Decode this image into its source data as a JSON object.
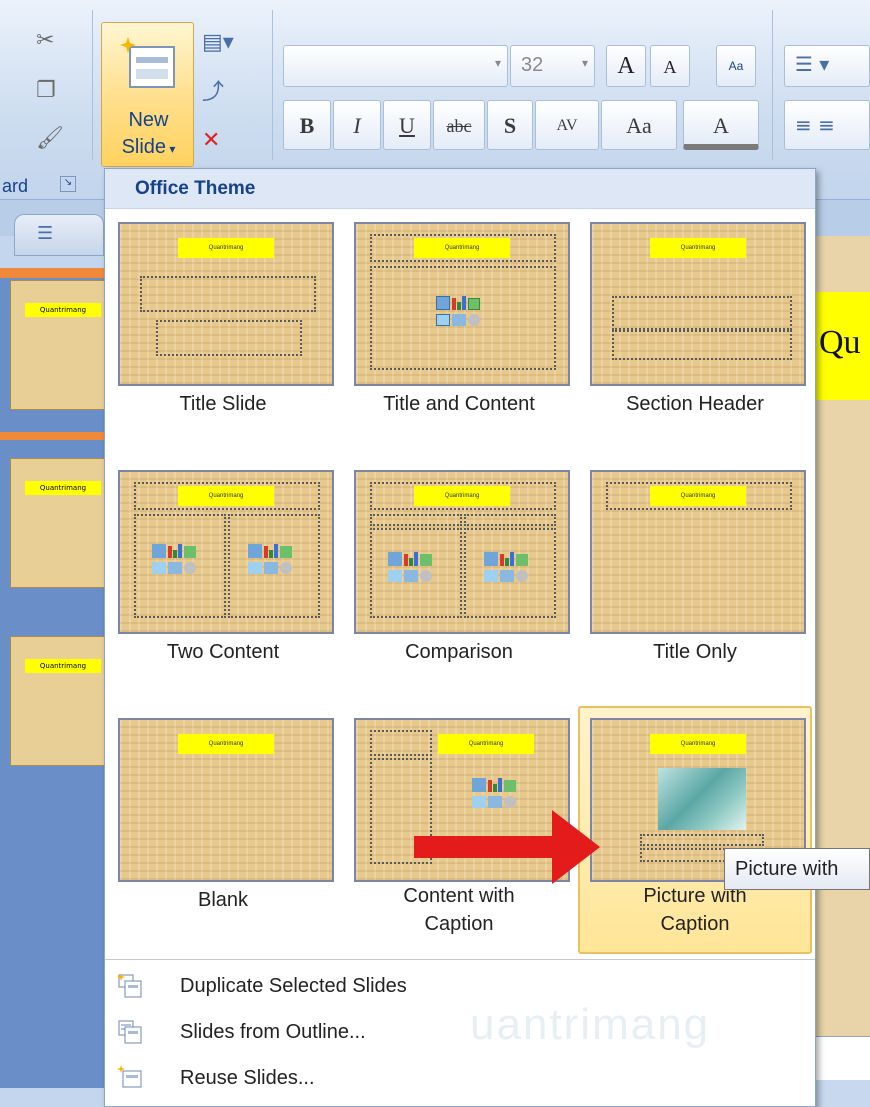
{
  "ribbon": {
    "new_slide_line1": "New",
    "new_slide_line2": "Slide",
    "font_size": "32",
    "clipboard_label": "ard",
    "format_buttons": [
      "B",
      "I",
      "U",
      "abc",
      "S",
      "AV",
      "Aa",
      "A"
    ]
  },
  "slides_panel": {
    "thumb_label": "Quantrimang"
  },
  "editor": {
    "title_fragment": "Qu"
  },
  "dropdown": {
    "header": "Office Theme",
    "layouts": [
      {
        "name": "Title Slide",
        "placeholder": "Quantrimang"
      },
      {
        "name": "Title and Content",
        "placeholder": "Quantrimang"
      },
      {
        "name": "Section Header",
        "placeholder": "Quantrimang"
      },
      {
        "name": "Two Content",
        "placeholder": "Quantrimang"
      },
      {
        "name": "Comparison",
        "placeholder": "Quantrimang"
      },
      {
        "name": "Title Only",
        "placeholder": "Quantrimang"
      },
      {
        "name": "Blank",
        "placeholder": "Quantrimang"
      },
      {
        "name_line1": "Content with",
        "name_line2": "Caption",
        "placeholder": "Quantrimang"
      },
      {
        "name_line1": "Picture with",
        "name_line2": "Caption",
        "placeholder": "Quantrimang",
        "selected": true
      }
    ],
    "menu_items": [
      {
        "label": "Duplicate Selected Slides",
        "icon": "duplicate-slides-icon"
      },
      {
        "label": "Slides from Outline...",
        "icon": "slides-from-outline-icon"
      },
      {
        "label": "Reuse Slides...",
        "icon": "reuse-slides-icon"
      }
    ]
  },
  "tooltip": "Picture with",
  "watermark": "uantrimang",
  "colors": {
    "accent": "#15428b",
    "selected_bg": "#ffe597",
    "arrow": "#e31b1b",
    "placeholder_yellow": "#ffff00"
  }
}
